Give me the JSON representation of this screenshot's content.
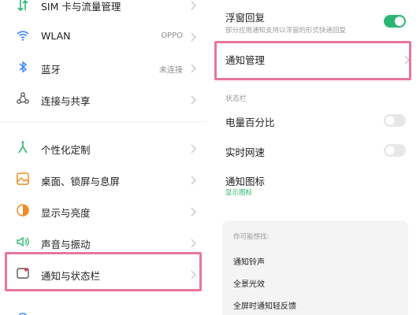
{
  "left": {
    "items": [
      {
        "label": "SIM 卡与流量管理",
        "value": "",
        "icon": "sim-data-icon"
      },
      {
        "label": "WLAN",
        "value": "OPPO",
        "icon": "wifi-icon"
      },
      {
        "label": "蓝牙",
        "value": "未连接",
        "icon": "bluetooth-icon"
      },
      {
        "label": "连接与共享",
        "value": "",
        "icon": "share-icon"
      },
      {
        "label": "个性化定制",
        "value": "",
        "icon": "personalize-icon"
      },
      {
        "label": "桌面、锁屏与息屏",
        "value": "",
        "icon": "wallpaper-icon"
      },
      {
        "label": "显示与亮度",
        "value": "",
        "icon": "display-icon"
      },
      {
        "label": "声音与振动",
        "value": "",
        "icon": "sound-icon"
      },
      {
        "label": "通知与状态栏",
        "value": "",
        "icon": "notification-icon"
      }
    ]
  },
  "right": {
    "floating": {
      "title": "浮窗回复",
      "subtitle": "部分应用通知支持以浮窗的形式快速回复",
      "enabled": true
    },
    "notification_mgmt": {
      "title": "通知管理"
    },
    "statusbar_header": "状态栏",
    "battery_percent": {
      "title": "电量百分比",
      "enabled": false
    },
    "net_speed": {
      "title": "实时网速",
      "enabled": false
    },
    "notif_icon": {
      "title": "通知图标",
      "link": "显示图标"
    },
    "suggest": {
      "header": "你可能想找:",
      "items": [
        "通知铃声",
        "全景光效",
        "全屏时通知轻反馈"
      ]
    }
  },
  "colors": {
    "accent_green": "#2bb673",
    "highlight_pink": "#e8759b"
  }
}
